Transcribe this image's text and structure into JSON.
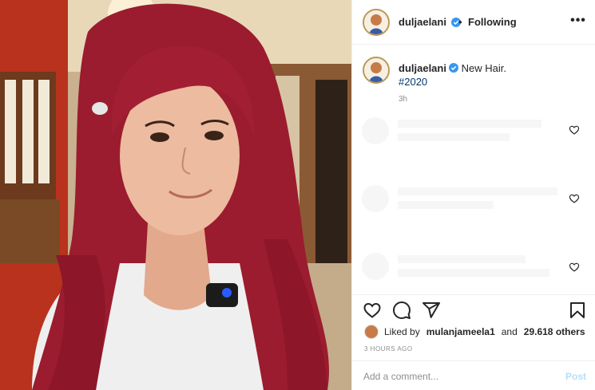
{
  "post": {
    "username": "duljaelani",
    "follow_status": "Following",
    "bullet": "•",
    "more_label": "•••",
    "caption_text": "New Hair.",
    "hashtag": "#2020",
    "time_ago": "3h",
    "liked_by_prefix": "Liked by",
    "liked_by_user": "mulanjameela1",
    "liked_by_and": "and",
    "likes_count": "29.618 others",
    "date": "3 HOURS AGO"
  },
  "comment": {
    "placeholder": "Add a comment...",
    "post_label": "Post"
  },
  "icons": {
    "verified": "verified-badge-icon",
    "like": "heart-icon",
    "comment": "comment-bubble-icon",
    "share": "paper-plane-icon",
    "save": "bookmark-icon",
    "more": "more-options-icon"
  },
  "colors": {
    "link": "#00376b",
    "verified": "#3897f0",
    "post_button_disabled": "#b2dffc",
    "secondary_text": "#8e8e8e",
    "hair": "#9b1c2e"
  }
}
